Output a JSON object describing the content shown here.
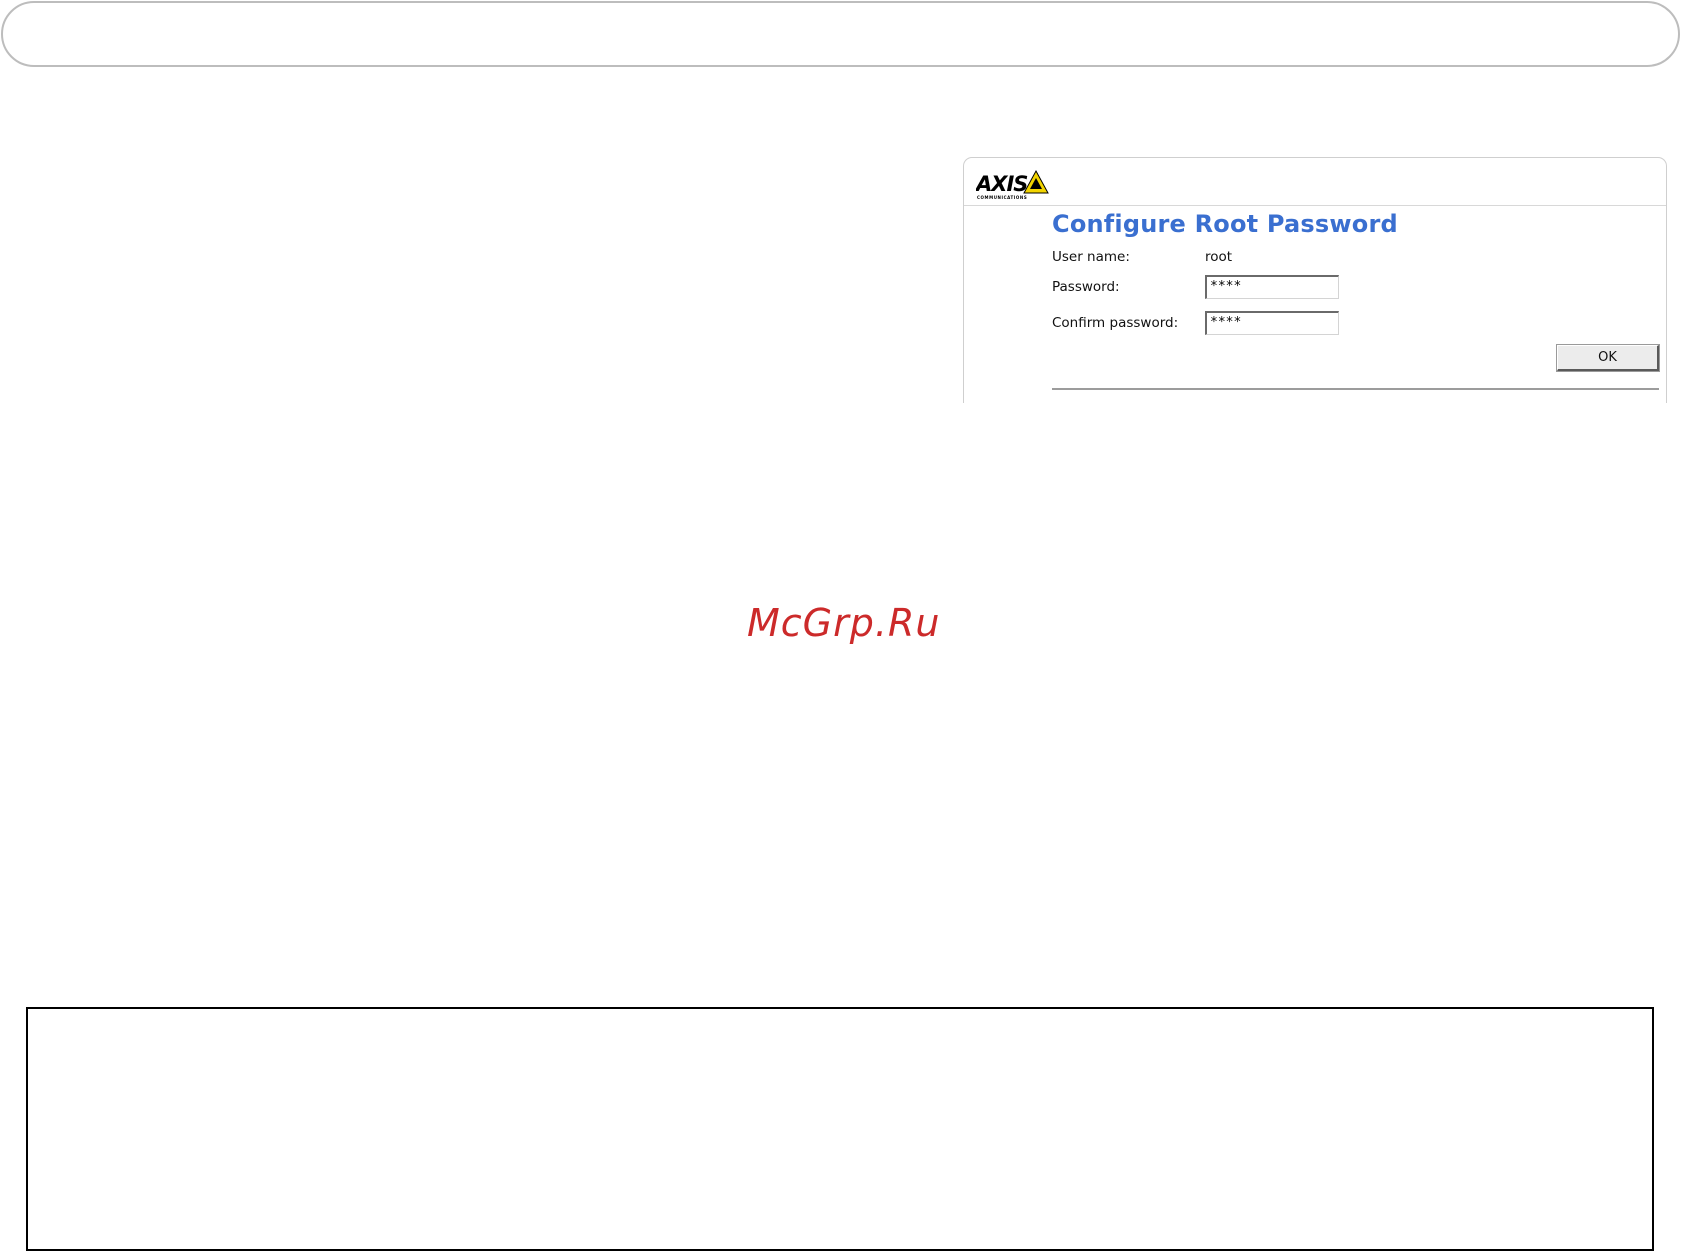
{
  "logo": {
    "brand": "AXIS",
    "tagline": "COMMUNICATIONS",
    "accent_color": "#f2d400"
  },
  "form": {
    "title": "Configure Root Password",
    "username_label": "User name:",
    "username_value": "root",
    "password_label": "Password:",
    "password_value": "****",
    "confirm_label": "Confirm password:",
    "confirm_value": "****",
    "ok_label": "OK"
  },
  "watermark": {
    "text": "McGrp.Ru",
    "color": "#cc2a2a"
  },
  "colors": {
    "title": "#3a6fd0"
  }
}
